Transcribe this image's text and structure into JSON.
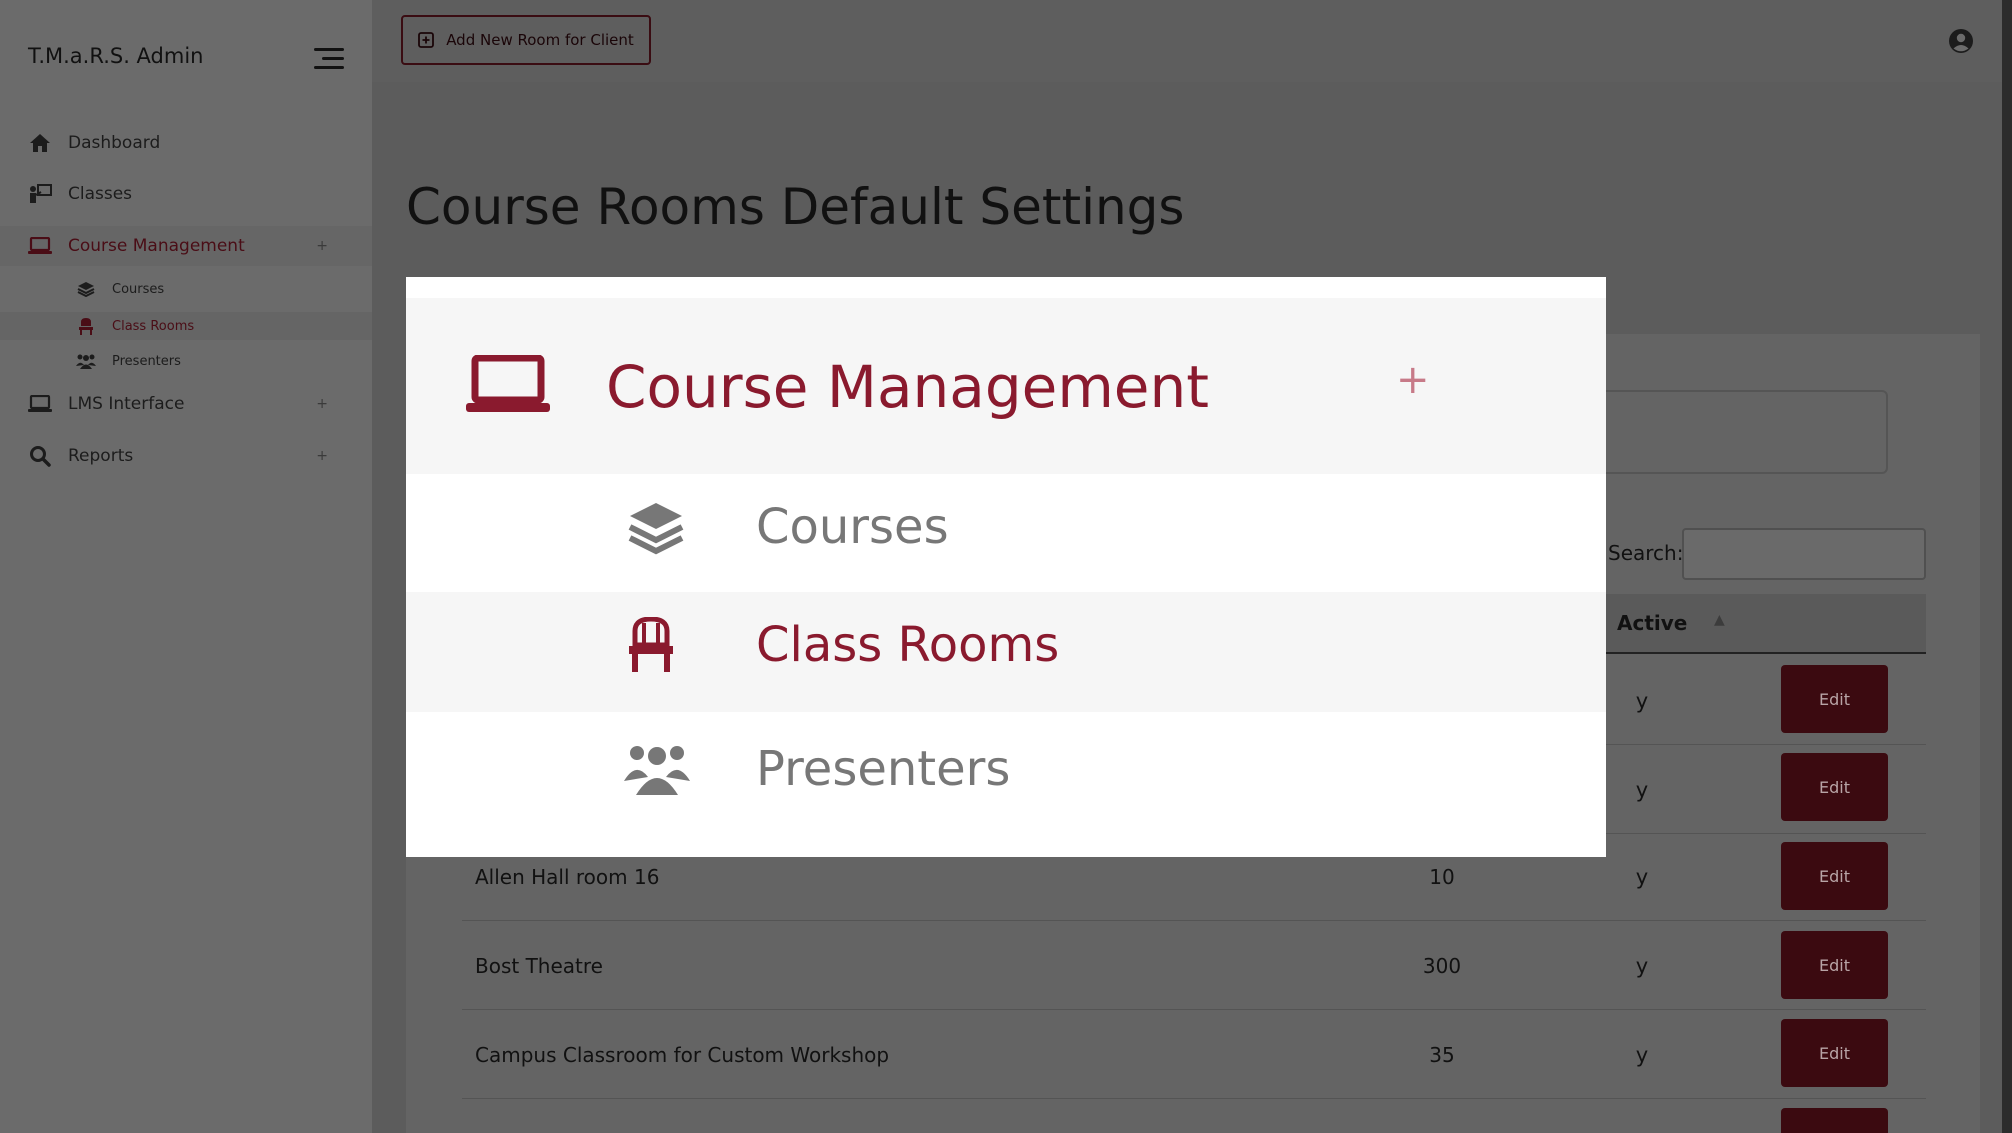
{
  "sidebar": {
    "brand": "T.M.a.R.S. Admin",
    "items": [
      {
        "label": "Dashboard",
        "icon": "home-icon"
      },
      {
        "label": "Classes",
        "icon": "teacher-board-icon"
      },
      {
        "label": "Course Management",
        "icon": "laptop-icon",
        "expand": "+"
      },
      {
        "label": "LMS Interface",
        "icon": "laptop-icon",
        "expand": "+"
      },
      {
        "label": "Reports",
        "icon": "search-icon",
        "expand": "+"
      }
    ],
    "sub_items": [
      {
        "label": "Courses",
        "icon": "layers-icon"
      },
      {
        "label": "Class Rooms",
        "icon": "chair-icon"
      },
      {
        "label": "Presenters",
        "icon": "users-icon"
      }
    ]
  },
  "header": {
    "add_button": "Add New Room for Client"
  },
  "main": {
    "title": "Course Rooms Default Settings",
    "search_label": "Search:",
    "columns": {
      "active": "Active"
    },
    "rows": [
      {
        "name": "",
        "capacity": "",
        "active": "y",
        "action": "Edit"
      },
      {
        "name": "",
        "capacity": "",
        "active": "y",
        "action": "Edit"
      },
      {
        "name": "Allen Hall room 16",
        "capacity": "10",
        "active": "y",
        "action": "Edit"
      },
      {
        "name": "Bost Theatre",
        "capacity": "300",
        "active": "y",
        "action": "Edit"
      },
      {
        "name": "Campus Classroom for Custom Workshop",
        "capacity": "35",
        "active": "y",
        "action": "Edit"
      }
    ]
  },
  "zoom": {
    "title": "Course Management",
    "expand": "+",
    "items": [
      "Courses",
      "Class Rooms",
      "Presenters"
    ]
  },
  "colors": {
    "accent": "#8a1a2e",
    "button_dark": "#3b0a10",
    "overlay_bg": "#5c5c5c"
  }
}
